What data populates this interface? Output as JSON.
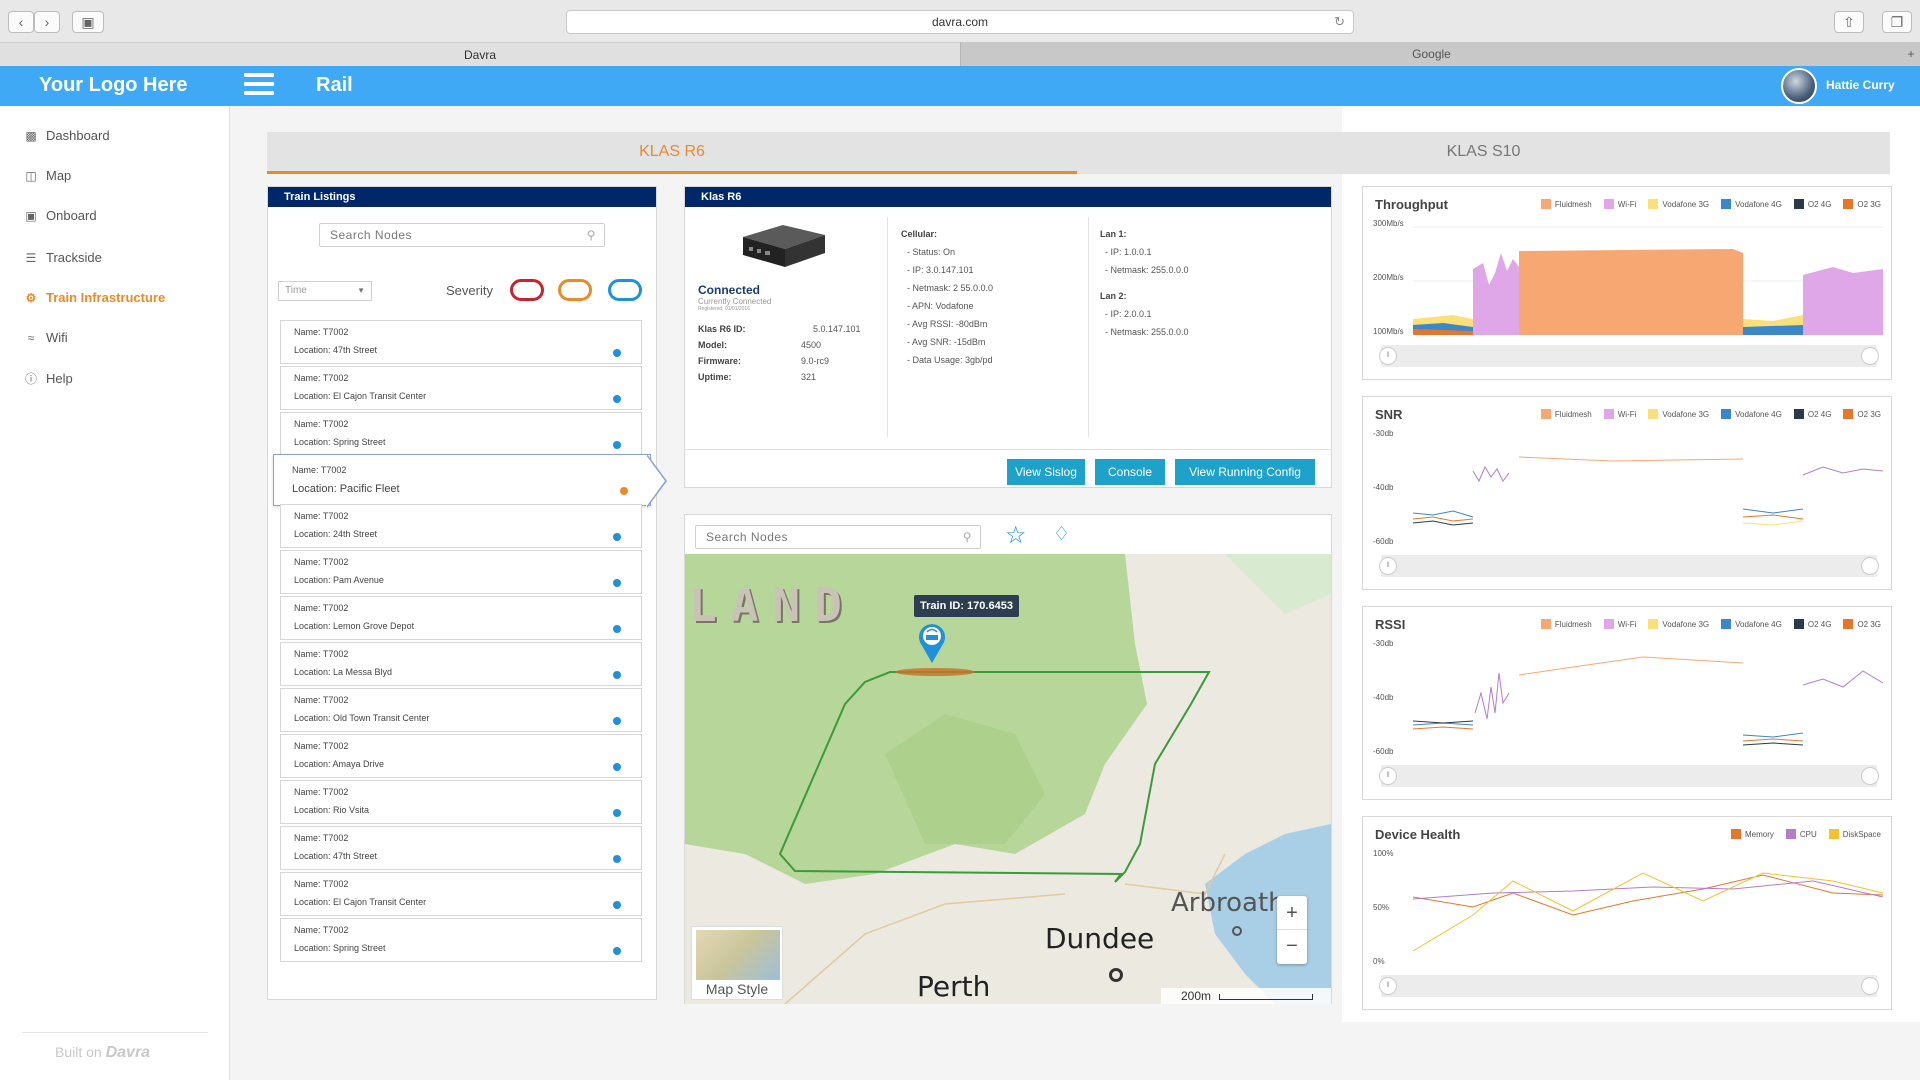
{
  "browser": {
    "url": "davra.com",
    "tabs": [
      "Davra",
      "Google"
    ],
    "new_tab": "+"
  },
  "app": {
    "logo": "Your Logo Here",
    "title": "Rail",
    "user": "Hattie Curry"
  },
  "sidebar": {
    "items": [
      {
        "label": "Dashboard",
        "icon": "bar-chart-icon",
        "active": false
      },
      {
        "label": "Map",
        "icon": "map-icon",
        "active": false
      },
      {
        "label": "Onboard",
        "icon": "train-icon",
        "active": false
      },
      {
        "label": "Trackside",
        "icon": "track-icon",
        "active": false
      },
      {
        "label": "Train Infrastructure",
        "icon": "gear-icon",
        "active": true
      },
      {
        "label": "Wifi",
        "icon": "wifi-icon",
        "active": false
      },
      {
        "label": "Help",
        "icon": "info-icon",
        "active": false
      }
    ],
    "built_on": "Built on",
    "brand": "Davra"
  },
  "tabs": {
    "active": "KLAS R6",
    "other": "KLAS S10"
  },
  "listings": {
    "header": "Train Listings",
    "search_placeholder": "Search Nodes",
    "time_label": "Time",
    "severity_label": "Severity",
    "toggle_colors": [
      "#c1272d",
      "#e98a2b",
      "#1f90d9"
    ],
    "name_prefix": "Name:",
    "location_prefix": "Location:",
    "items": [
      {
        "name": "T7002",
        "location": "47th Street"
      },
      {
        "name": "T7002",
        "location": "El Cajon Transit Center"
      },
      {
        "name": "T7002",
        "location": "Spring Street"
      },
      {
        "name": "T7002",
        "location": "Pacific Fleet",
        "selected": true
      },
      {
        "name": "T7002",
        "location": "24th Street"
      },
      {
        "name": "T7002",
        "location": "Pam Avenue"
      },
      {
        "name": "T7002",
        "location": "Lemon Grove Depot"
      },
      {
        "name": "T7002",
        "location": "La Messa  Blyd"
      },
      {
        "name": "T7002",
        "location": "Old Town Transit Center"
      },
      {
        "name": "T7002",
        "location": "Amaya Drive"
      },
      {
        "name": "T7002",
        "location": "Rio Vsita"
      },
      {
        "name": "T7002",
        "location": "47th Street"
      },
      {
        "name": "T7002",
        "location": "El Cajon Transit Center"
      },
      {
        "name": "T7002",
        "location": "Spring Street"
      }
    ]
  },
  "device": {
    "header": "Klas R6",
    "status": "Connected",
    "status_sub": "Currently Connected",
    "registered": "Registered: 01/01/2016",
    "fields": [
      {
        "label": "Klas R6 ID:",
        "value": "5.0.147.101"
      },
      {
        "label": "Model:",
        "value": "4500"
      },
      {
        "label": "Firmware:",
        "value": "9.0-rc9"
      },
      {
        "label": "Uptime:",
        "value": "321"
      }
    ],
    "cellular_title": "Cellular:",
    "cellular": [
      "- Status: On",
      "- IP: 3.0.147.101",
      "- Netmask: 2 55.0.0.0",
      "- APN: Vodafone",
      "- Avg RSSI: -80dBm",
      "- Avg SNR: -15dBm",
      "- Data Usage: 3gb/pd"
    ],
    "lan1_title": "Lan 1:",
    "lan1": [
      "- IP: 1.0.0.1",
      "- Netmask: 255.0.0.0"
    ],
    "lan2_title": "Lan 2:",
    "lan2": [
      "- IP: 2.0.0.1",
      "- Netmask: 255.0.0.0"
    ],
    "buttons": [
      "View Sislog",
      "Console",
      "View Running Config"
    ]
  },
  "map": {
    "search_placeholder": "Search Nodes",
    "tooltip": "Train ID: 170.6453",
    "labels": [
      "LAND",
      "Arbroath",
      "Dundee",
      "Perth"
    ],
    "zoom_in": "+",
    "zoom_out": "−",
    "style_label": "Map Style",
    "scale": "200m"
  },
  "charts": {
    "throughput": {
      "title": "Throughput",
      "legend": [
        {
          "name": "Fluidmesh",
          "color": "#f7a872"
        },
        {
          "name": "Wi-Fi",
          "color": "#dfa6e8"
        },
        {
          "name": "Vodafone 3G",
          "color": "#fbe07a"
        },
        {
          "name": "Vodafone 4G",
          "color": "#3a87c9"
        },
        {
          "name": "O2 4G",
          "color": "#2b3a4a"
        },
        {
          "name": "O2 3G",
          "color": "#e5762b"
        }
      ],
      "yticks": [
        "300Mb/s",
        "200Mb/s",
        "100Mb/s"
      ]
    },
    "snr": {
      "title": "SNR",
      "legend": [
        {
          "name": "Fluidmesh",
          "color": "#f7a872"
        },
        {
          "name": "Wi-Fi",
          "color": "#dfa6e8"
        },
        {
          "name": "Vodafone 3G",
          "color": "#fbe07a"
        },
        {
          "name": "Vodafone 4G",
          "color": "#3a87c9"
        },
        {
          "name": "O2 4G",
          "color": "#2b3a4a"
        },
        {
          "name": "O2 3G",
          "color": "#e5762b"
        }
      ],
      "yticks": [
        "-30db",
        "-40db",
        "-60db"
      ]
    },
    "rssi": {
      "title": "RSSI",
      "legend": [
        {
          "name": "Fluidmesh",
          "color": "#f7a872"
        },
        {
          "name": "Wi-Fi",
          "color": "#dfa6e8"
        },
        {
          "name": "Vodafone 3G",
          "color": "#fbe07a"
        },
        {
          "name": "Vodafone 4G",
          "color": "#3a87c9"
        },
        {
          "name": "O2 4G",
          "color": "#2b3a4a"
        },
        {
          "name": "O2 3G",
          "color": "#e5762b"
        }
      ],
      "yticks": [
        "-30db",
        "-40db",
        "-60db"
      ]
    },
    "health": {
      "title": "Device Health",
      "legend": [
        {
          "name": "Memory",
          "color": "#e5762b"
        },
        {
          "name": "CPU",
          "color": "#b57cc9"
        },
        {
          "name": "DiskSpace",
          "color": "#f2c12e"
        }
      ],
      "yticks": [
        "100%",
        "50%",
        "0%"
      ]
    }
  }
}
